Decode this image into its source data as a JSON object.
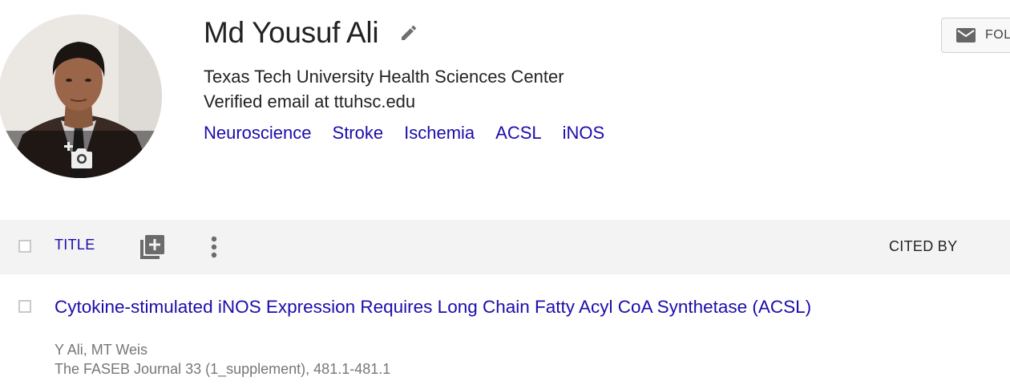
{
  "profile": {
    "name": "Md Yousuf Ali",
    "affiliation": "Texas Tech University Health Sciences Center",
    "email": "Verified email at ttuhsc.edu",
    "interests": [
      "Neuroscience",
      "Stroke",
      "Ischemia",
      "ACSL",
      "iNOS"
    ],
    "avatar_icon": "person-photo",
    "change_photo_icon": "add-photo-camera-icon",
    "edit_icon": "pencil-icon"
  },
  "follow": {
    "label": "FOL",
    "icon": "mail-icon"
  },
  "table_header": {
    "title_label": "TITLE",
    "cited_by_label": "CITED BY",
    "add_icon": "add-to-library-icon",
    "more_icon": "more-vert-icon"
  },
  "articles": [
    {
      "title": "Cytokine-stimulated iNOS Expression Requires Long Chain Fatty Acyl CoA Synthetase (ACSL)",
      "authors": "Y Ali, MT Weis",
      "venue": "The FASEB Journal 33 (1_supplement), 481.1-481.1"
    }
  ],
  "colors": {
    "link": "#1a0dab",
    "text": "#222222",
    "muted": "#777777",
    "header_bg": "#f3f3f3"
  }
}
